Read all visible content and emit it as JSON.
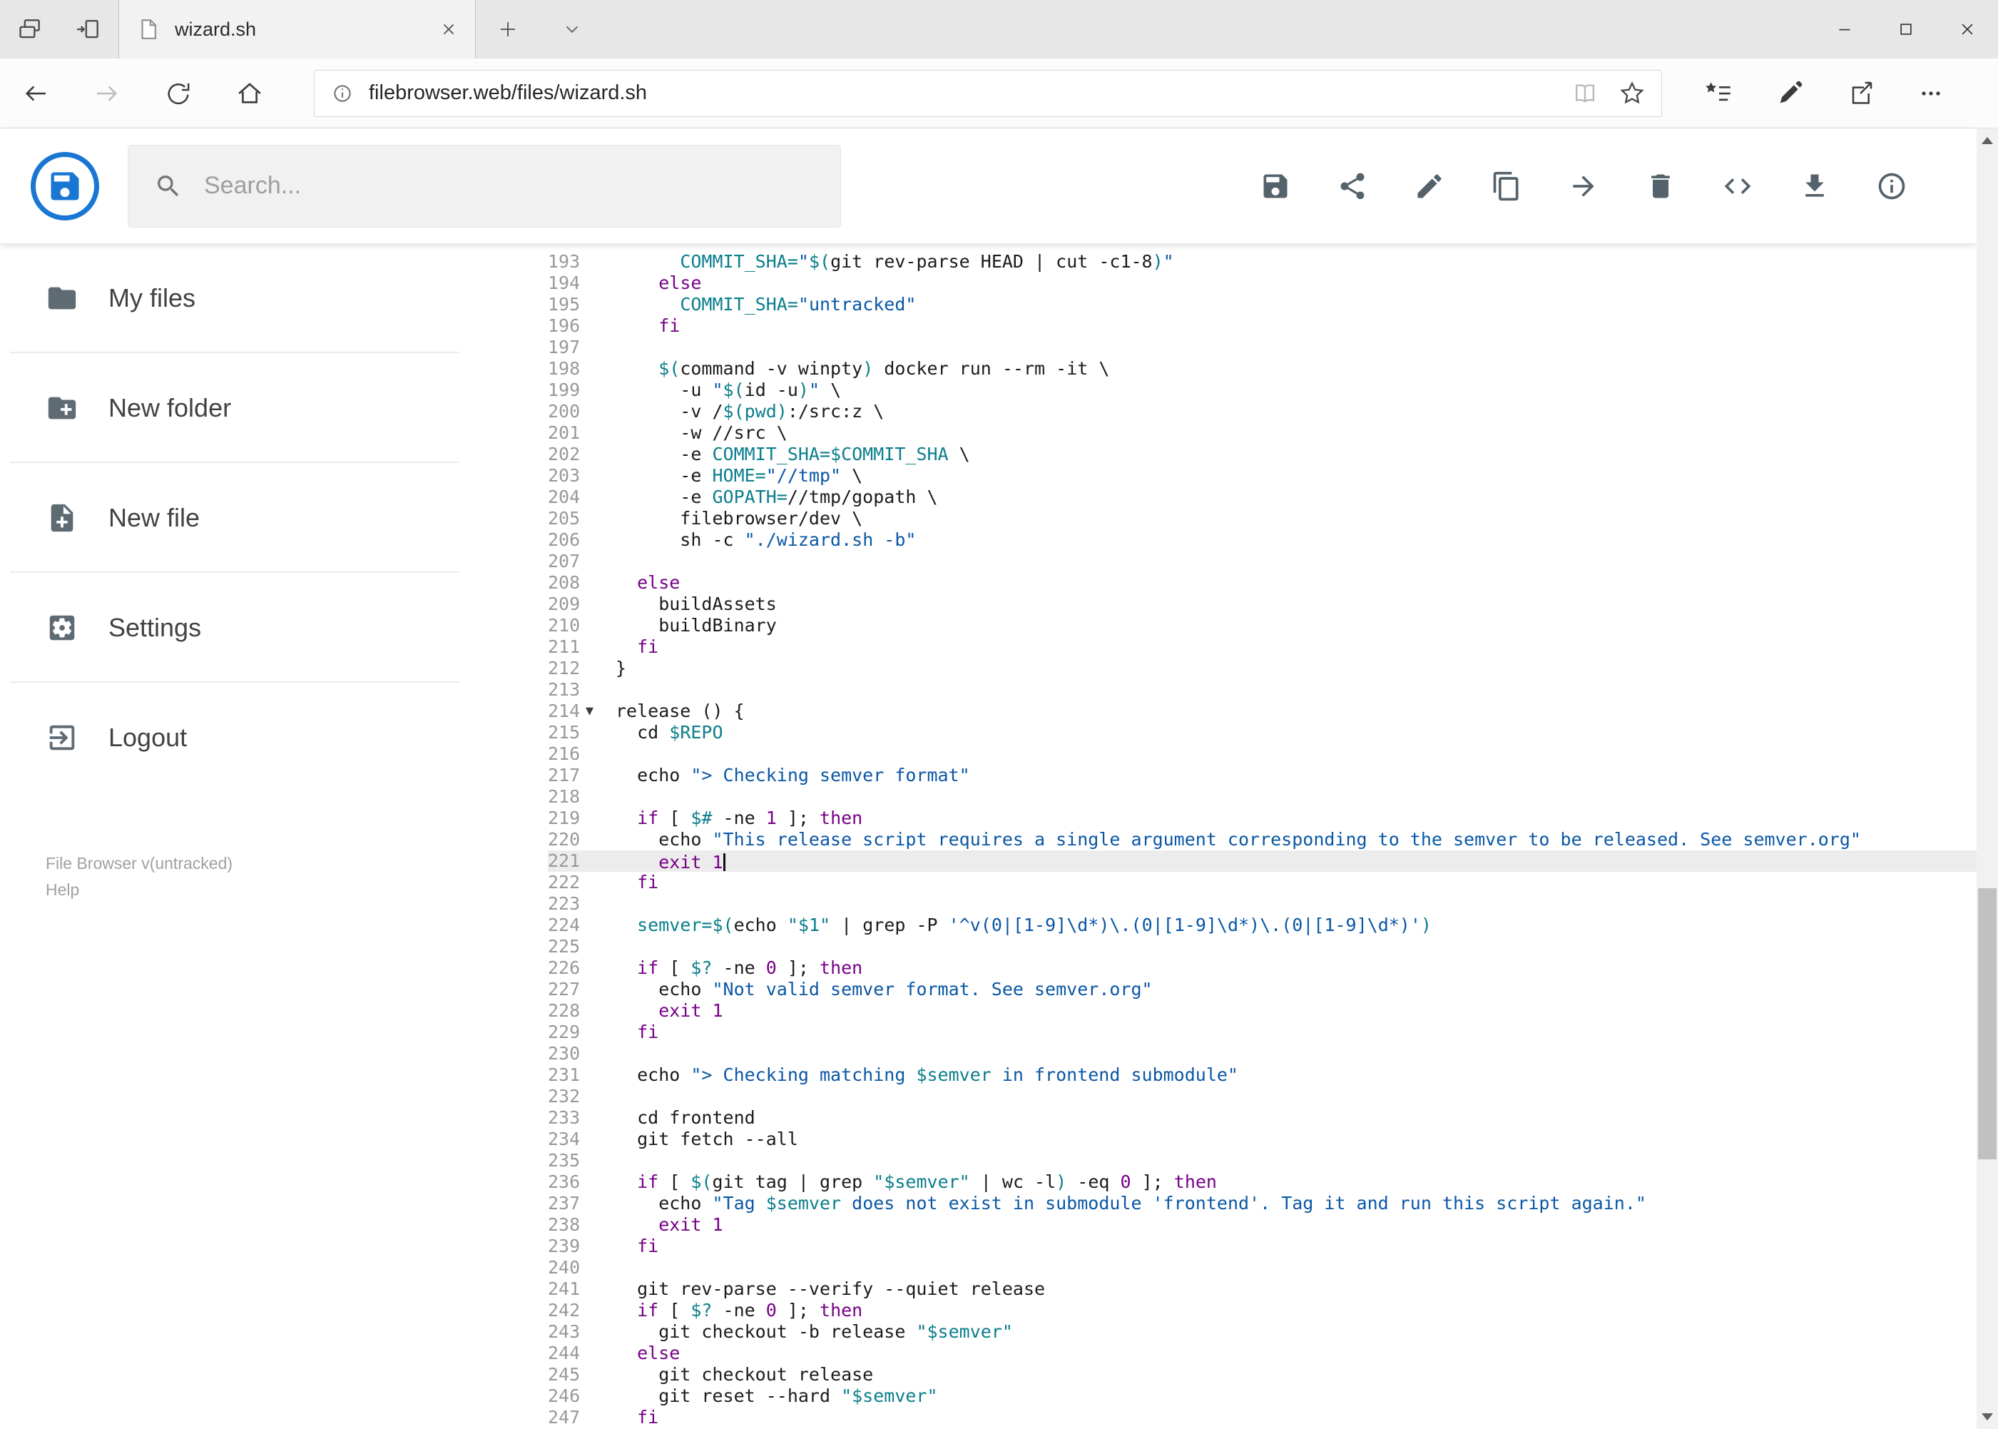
{
  "window": {
    "tab_title": "wizard.sh",
    "url": "filebrowser.web/files/wizard.sh"
  },
  "header": {
    "search_placeholder": "Search...",
    "toolbar_buttons": [
      "save",
      "share",
      "rename",
      "copy",
      "move",
      "delete",
      "code",
      "download",
      "info"
    ]
  },
  "sidebar": {
    "items": [
      {
        "label": "My files",
        "icon": "folder-icon"
      },
      {
        "label": "New folder",
        "icon": "create-folder-icon"
      },
      {
        "label": "New file",
        "icon": "create-file-icon"
      },
      {
        "label": "Settings",
        "icon": "settings-icon"
      },
      {
        "label": "Logout",
        "icon": "logout-icon"
      }
    ],
    "footer": {
      "version": "File Browser v(untracked)",
      "help": "Help"
    }
  },
  "colors": {
    "accent": "#1976d2",
    "keyword": "#770088",
    "variable": "#0b7e8c",
    "string": "#0a57a5",
    "number": "#770088",
    "active_line": "#ececec",
    "line_number": "#999999"
  },
  "editor": {
    "active_line": 221,
    "fold_line": 214,
    "lines": [
      {
        "n": 193,
        "s": [
          [
            "pl",
            "      "
          ],
          [
            "vr",
            "COMMIT_SHA="
          ],
          [
            "st",
            "\""
          ],
          [
            "vr",
            "$("
          ],
          [
            "pl",
            "git rev-parse HEAD | cut -c1-8"
          ],
          [
            "vr",
            ")"
          ],
          [
            "st",
            "\""
          ]
        ]
      },
      {
        "n": 194,
        "s": [
          [
            "pl",
            "    "
          ],
          [
            "kw",
            "else"
          ]
        ]
      },
      {
        "n": 195,
        "s": [
          [
            "pl",
            "      "
          ],
          [
            "vr",
            "COMMIT_SHA="
          ],
          [
            "st",
            "\"untracked\""
          ]
        ]
      },
      {
        "n": 196,
        "s": [
          [
            "pl",
            "    "
          ],
          [
            "kw",
            "fi"
          ]
        ]
      },
      {
        "n": 197,
        "s": []
      },
      {
        "n": 198,
        "s": [
          [
            "pl",
            "    "
          ],
          [
            "vr",
            "$("
          ],
          [
            "pl",
            "command -v winpty"
          ],
          [
            "vr",
            ")"
          ],
          [
            "pl",
            " docker run --rm -it \\"
          ]
        ]
      },
      {
        "n": 199,
        "s": [
          [
            "pl",
            "      -u "
          ],
          [
            "st",
            "\""
          ],
          [
            "vr",
            "$("
          ],
          [
            "pl",
            "id -u"
          ],
          [
            "vr",
            ")"
          ],
          [
            "st",
            "\""
          ],
          [
            "pl",
            " \\"
          ]
        ]
      },
      {
        "n": 200,
        "s": [
          [
            "pl",
            "      -v /"
          ],
          [
            "vr",
            "$(pwd)"
          ],
          [
            "pl",
            ":/src:z \\"
          ]
        ]
      },
      {
        "n": 201,
        "s": [
          [
            "pl",
            "      -w //src \\"
          ]
        ]
      },
      {
        "n": 202,
        "s": [
          [
            "pl",
            "      -e "
          ],
          [
            "vr",
            "COMMIT_SHA=$COMMIT_SHA"
          ],
          [
            "pl",
            " \\"
          ]
        ]
      },
      {
        "n": 203,
        "s": [
          [
            "pl",
            "      -e "
          ],
          [
            "vr",
            "HOME="
          ],
          [
            "st",
            "\"//tmp\""
          ],
          [
            "pl",
            " \\"
          ]
        ]
      },
      {
        "n": 204,
        "s": [
          [
            "pl",
            "      -e "
          ],
          [
            "vr",
            "GOPATH="
          ],
          [
            "pl",
            "//tmp/gopath \\"
          ]
        ]
      },
      {
        "n": 205,
        "s": [
          [
            "pl",
            "      filebrowser/dev \\"
          ]
        ]
      },
      {
        "n": 206,
        "s": [
          [
            "pl",
            "      sh -c "
          ],
          [
            "st",
            "\"./wizard.sh -b\""
          ]
        ]
      },
      {
        "n": 207,
        "s": []
      },
      {
        "n": 208,
        "s": [
          [
            "pl",
            "  "
          ],
          [
            "kw",
            "else"
          ]
        ]
      },
      {
        "n": 209,
        "s": [
          [
            "pl",
            "    buildAssets"
          ]
        ]
      },
      {
        "n": 210,
        "s": [
          [
            "pl",
            "    buildBinary"
          ]
        ]
      },
      {
        "n": 211,
        "s": [
          [
            "pl",
            "  "
          ],
          [
            "kw",
            "fi"
          ]
        ]
      },
      {
        "n": 212,
        "s": [
          [
            "pl",
            "}"
          ]
        ]
      },
      {
        "n": 213,
        "s": []
      },
      {
        "n": 214,
        "s": [
          [
            "pl",
            "release () {"
          ]
        ]
      },
      {
        "n": 215,
        "s": [
          [
            "pl",
            "  cd "
          ],
          [
            "vr",
            "$REPO"
          ]
        ]
      },
      {
        "n": 216,
        "s": []
      },
      {
        "n": 217,
        "s": [
          [
            "pl",
            "  echo "
          ],
          [
            "st",
            "\"> Checking semver format\""
          ]
        ]
      },
      {
        "n": 218,
        "s": []
      },
      {
        "n": 219,
        "s": [
          [
            "pl",
            "  "
          ],
          [
            "kw",
            "if"
          ],
          [
            "pl",
            " [ "
          ],
          [
            "vr",
            "$#"
          ],
          [
            "pl",
            " -ne "
          ],
          [
            "nu",
            "1"
          ],
          [
            "pl",
            " ]; "
          ],
          [
            "kw",
            "then"
          ]
        ]
      },
      {
        "n": 220,
        "s": [
          [
            "pl",
            "    echo "
          ],
          [
            "st",
            "\"This release script requires a single argument corresponding to the semver to be released. See semver.org\""
          ]
        ]
      },
      {
        "n": 221,
        "s": [
          [
            "pl",
            "    "
          ],
          [
            "kw",
            "exit"
          ],
          [
            "pl",
            " "
          ],
          [
            "nu",
            "1"
          ]
        ]
      },
      {
        "n": 222,
        "s": [
          [
            "pl",
            "  "
          ],
          [
            "kw",
            "fi"
          ]
        ]
      },
      {
        "n": 223,
        "s": []
      },
      {
        "n": 224,
        "s": [
          [
            "pl",
            "  "
          ],
          [
            "vr",
            "semver=$("
          ],
          [
            "pl",
            "echo "
          ],
          [
            "vr",
            "\"$1\""
          ],
          [
            "pl",
            " | grep -P "
          ],
          [
            "st",
            "'^v(0|[1-9]\\d*)\\.(0|[1-9]\\d*)\\.(0|[1-9]\\d*)'"
          ],
          [
            "vr",
            ")"
          ]
        ]
      },
      {
        "n": 225,
        "s": []
      },
      {
        "n": 226,
        "s": [
          [
            "pl",
            "  "
          ],
          [
            "kw",
            "if"
          ],
          [
            "pl",
            " [ "
          ],
          [
            "vr",
            "$?"
          ],
          [
            "pl",
            " -ne "
          ],
          [
            "nu",
            "0"
          ],
          [
            "pl",
            " ]; "
          ],
          [
            "kw",
            "then"
          ]
        ]
      },
      {
        "n": 227,
        "s": [
          [
            "pl",
            "    echo "
          ],
          [
            "st",
            "\"Not valid semver format. See semver.org\""
          ]
        ]
      },
      {
        "n": 228,
        "s": [
          [
            "pl",
            "    "
          ],
          [
            "kw",
            "exit"
          ],
          [
            "pl",
            " "
          ],
          [
            "nu",
            "1"
          ]
        ]
      },
      {
        "n": 229,
        "s": [
          [
            "pl",
            "  "
          ],
          [
            "kw",
            "fi"
          ]
        ]
      },
      {
        "n": 230,
        "s": []
      },
      {
        "n": 231,
        "s": [
          [
            "pl",
            "  echo "
          ],
          [
            "st",
            "\"> Checking matching "
          ],
          [
            "vr",
            "$semver"
          ],
          [
            "st",
            " in frontend submodule\""
          ]
        ]
      },
      {
        "n": 232,
        "s": []
      },
      {
        "n": 233,
        "s": [
          [
            "pl",
            "  cd frontend"
          ]
        ]
      },
      {
        "n": 234,
        "s": [
          [
            "pl",
            "  git fetch --all"
          ]
        ]
      },
      {
        "n": 235,
        "s": []
      },
      {
        "n": 236,
        "s": [
          [
            "pl",
            "  "
          ],
          [
            "kw",
            "if"
          ],
          [
            "pl",
            " [ "
          ],
          [
            "vr",
            "$("
          ],
          [
            "pl",
            "git tag | grep "
          ],
          [
            "vr",
            "\"$semver\""
          ],
          [
            "pl",
            " | wc -l"
          ],
          [
            "vr",
            ")"
          ],
          [
            "pl",
            " -eq "
          ],
          [
            "nu",
            "0"
          ],
          [
            "pl",
            " ]; "
          ],
          [
            "kw",
            "then"
          ]
        ]
      },
      {
        "n": 237,
        "s": [
          [
            "pl",
            "    echo "
          ],
          [
            "st",
            "\"Tag "
          ],
          [
            "vr",
            "$semver"
          ],
          [
            "st",
            " does not exist in submodule 'frontend'. Tag it and run this script again.\""
          ]
        ]
      },
      {
        "n": 238,
        "s": [
          [
            "pl",
            "    "
          ],
          [
            "kw",
            "exit"
          ],
          [
            "pl",
            " "
          ],
          [
            "nu",
            "1"
          ]
        ]
      },
      {
        "n": 239,
        "s": [
          [
            "pl",
            "  "
          ],
          [
            "kw",
            "fi"
          ]
        ]
      },
      {
        "n": 240,
        "s": []
      },
      {
        "n": 241,
        "s": [
          [
            "pl",
            "  git rev-parse --verify --quiet release"
          ]
        ]
      },
      {
        "n": 242,
        "s": [
          [
            "pl",
            "  "
          ],
          [
            "kw",
            "if"
          ],
          [
            "pl",
            " [ "
          ],
          [
            "vr",
            "$?"
          ],
          [
            "pl",
            " -ne "
          ],
          [
            "nu",
            "0"
          ],
          [
            "pl",
            " ]; "
          ],
          [
            "kw",
            "then"
          ]
        ]
      },
      {
        "n": 243,
        "s": [
          [
            "pl",
            "    git checkout -b release "
          ],
          [
            "vr",
            "\"$semver\""
          ]
        ]
      },
      {
        "n": 244,
        "s": [
          [
            "pl",
            "  "
          ],
          [
            "kw",
            "else"
          ]
        ]
      },
      {
        "n": 245,
        "s": [
          [
            "pl",
            "    git checkout release"
          ]
        ]
      },
      {
        "n": 246,
        "s": [
          [
            "pl",
            "    git reset --hard "
          ],
          [
            "vr",
            "\"$semver\""
          ]
        ]
      },
      {
        "n": 247,
        "s": [
          [
            "pl",
            "  "
          ],
          [
            "kw",
            "fi"
          ]
        ]
      }
    ]
  }
}
